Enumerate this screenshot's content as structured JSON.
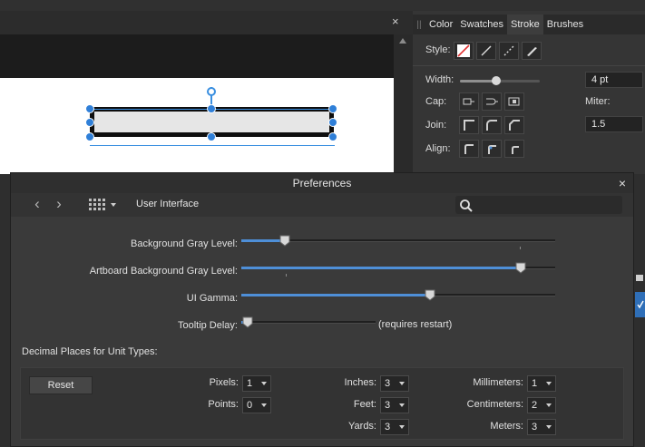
{
  "document": {
    "close_glyph": "×"
  },
  "stroke_panel": {
    "tabs": [
      {
        "label": "Color",
        "active": false
      },
      {
        "label": "Swatches",
        "active": false
      },
      {
        "label": "Stroke",
        "active": true
      },
      {
        "label": "Brushes",
        "active": false
      }
    ],
    "style_label": "Style:",
    "style_icons": [
      "no-stroke-icon",
      "solid-line-icon",
      "dashed-line-icon",
      "brush-stroke-icon"
    ],
    "width_label": "Width:",
    "width_value": "4 pt",
    "width_slider_fraction": 0.45,
    "cap_label": "Cap:",
    "cap_icons": [
      "butt-cap-icon",
      "round-cap-icon",
      "square-cap-icon"
    ],
    "miter_label": "Miter:",
    "miter_value": "1.5",
    "join_label": "Join:",
    "join_icons": [
      "miter-join-icon",
      "round-join-icon",
      "bevel-join-icon"
    ],
    "align_label": "Align:",
    "align_icons": [
      "align-inside-icon",
      "align-center-icon",
      "align-outside-icon"
    ]
  },
  "preferences": {
    "title": "Preferences",
    "close_glyph": "×",
    "back_glyph": "‹",
    "forward_glyph": "›",
    "section": "User Interface",
    "search_placeholder": "",
    "sliders": [
      {
        "label": "Background Gray Level:",
        "fraction": 0.14
      },
      {
        "label": "Artboard Background Gray Level:",
        "fraction": 0.89
      },
      {
        "label": "UI Gamma:",
        "fraction": 0.6
      }
    ],
    "tooltip_delay": {
      "label": "Tooltip Delay:",
      "fraction": 0.05,
      "note": "(requires restart)"
    },
    "decimals_label": "Decimal Places for Unit Types:",
    "reset_label": "Reset",
    "units": [
      {
        "label": "Pixels:",
        "value": "1"
      },
      {
        "label": "Points:",
        "value": "0"
      },
      {
        "label": "Inches:",
        "value": "3"
      },
      {
        "label": "Feet:",
        "value": "3"
      },
      {
        "label": "Yards:",
        "value": "3"
      },
      {
        "label": "Millimeters:",
        "value": "1"
      },
      {
        "label": "Centimeters:",
        "value": "2"
      },
      {
        "label": "Meters:",
        "value": "3"
      }
    ]
  },
  "colors": {
    "accent": "#4e8fd8",
    "selection": "#3a8fe0",
    "panel_bg": "#353535",
    "dialog_bg": "#3a3a3a"
  }
}
